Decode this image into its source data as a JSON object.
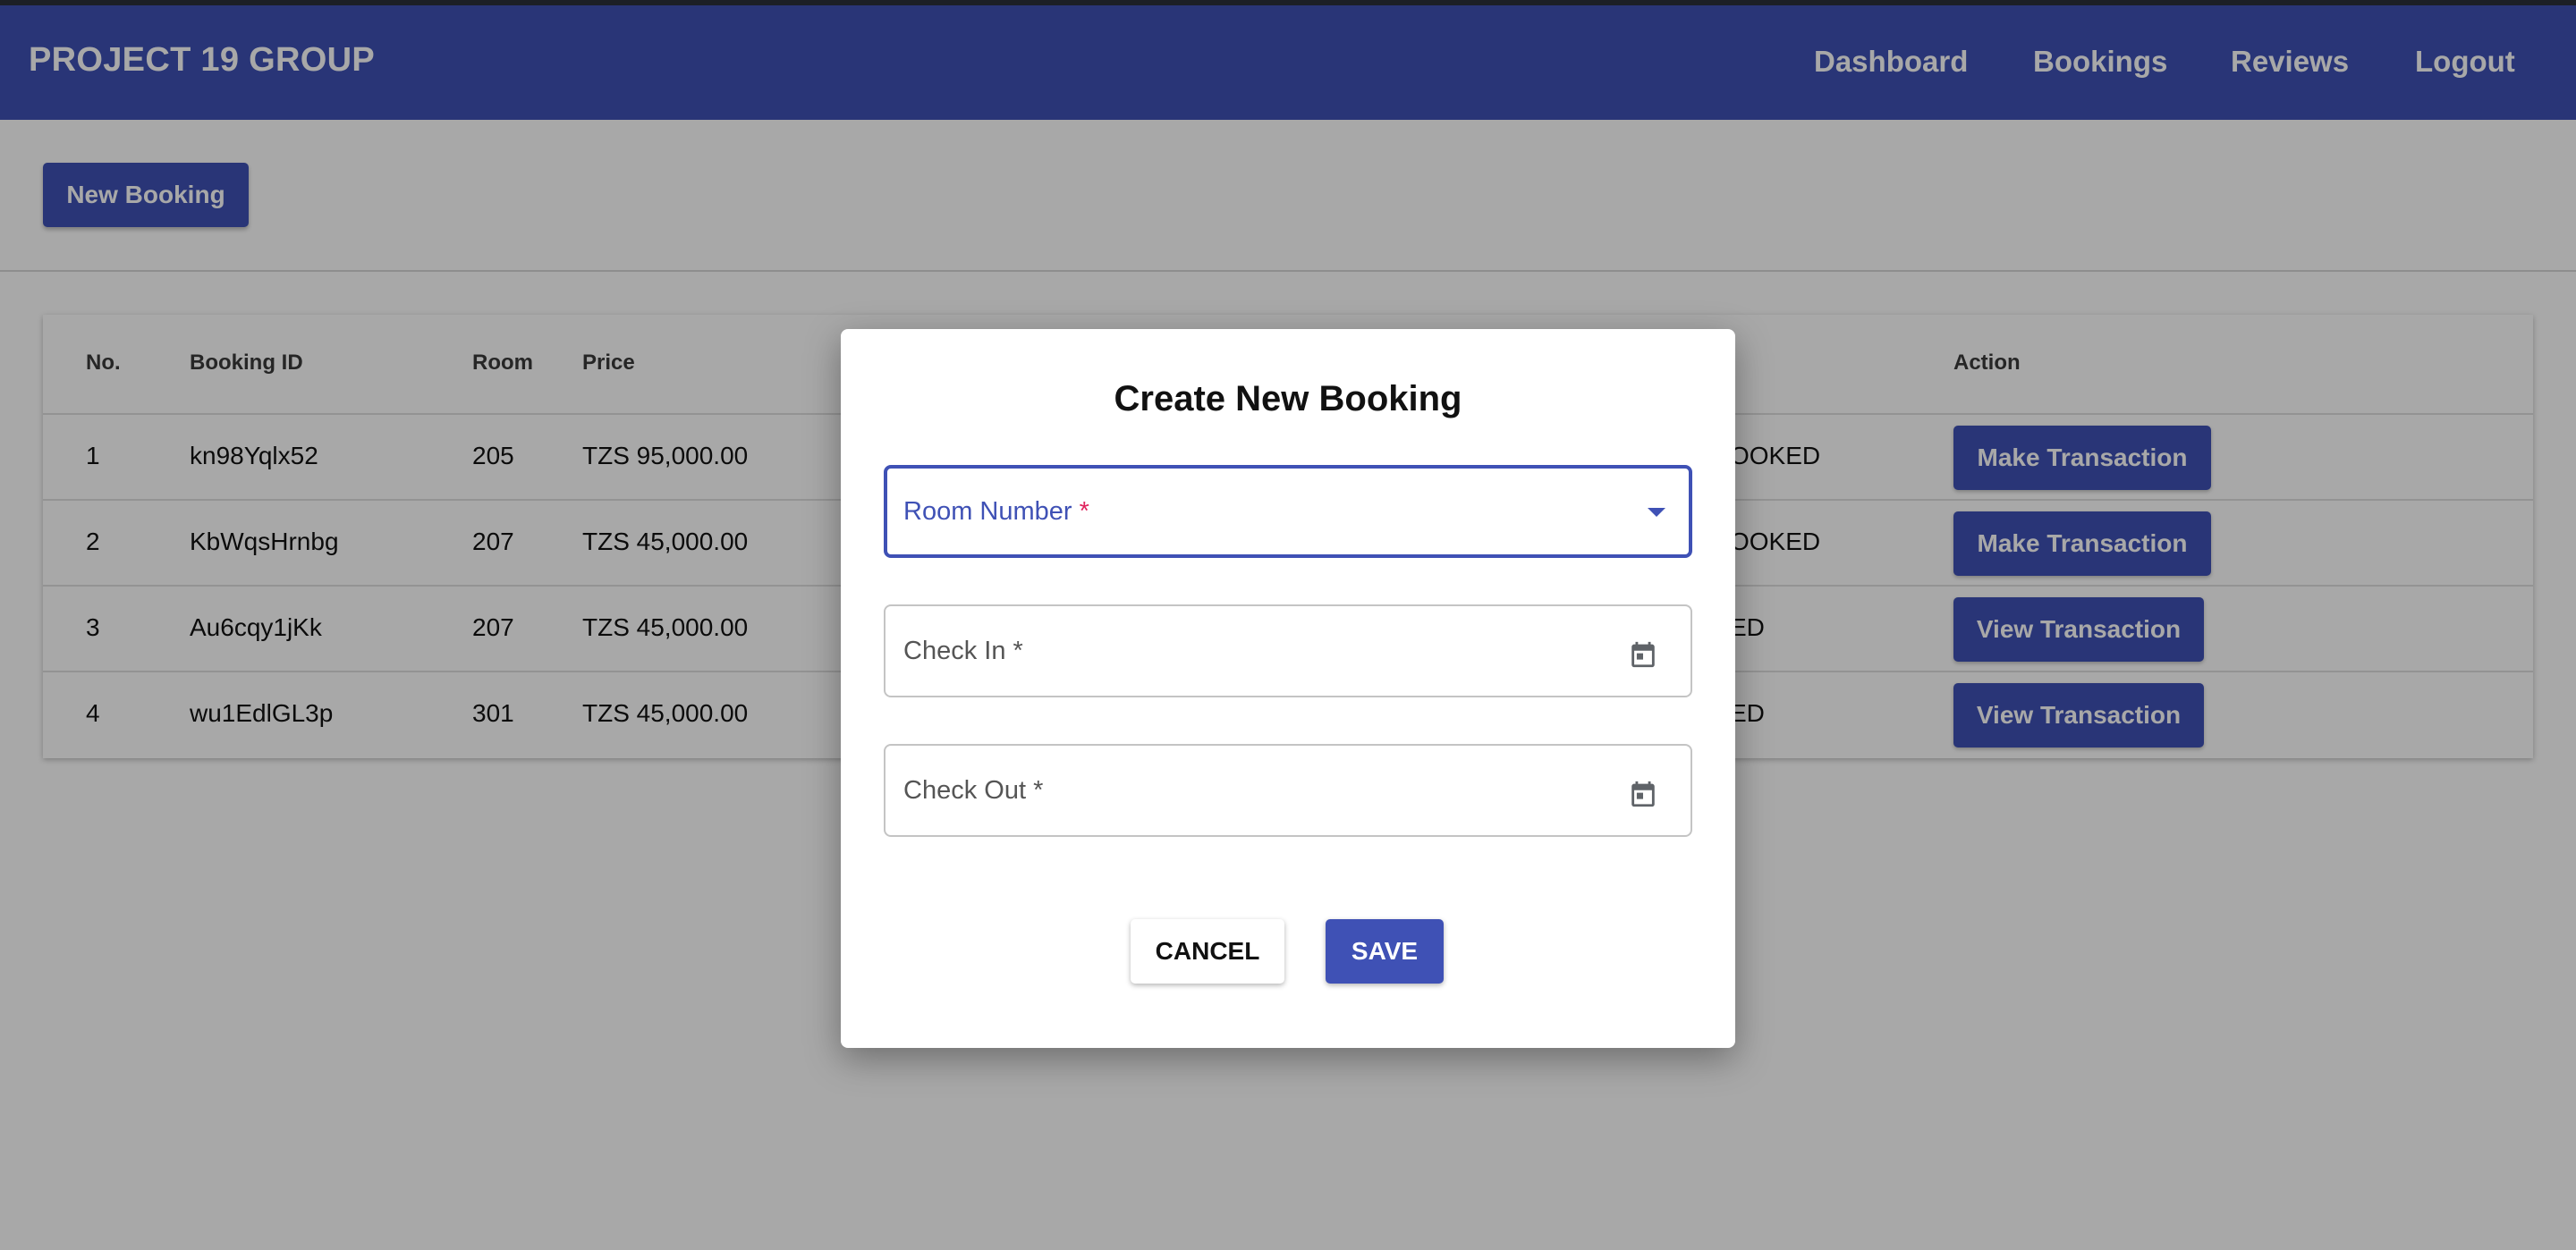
{
  "header": {
    "brand": "PROJECT 19 GROUP",
    "nav": [
      "Dashboard",
      "Bookings",
      "Reviews",
      "Logout"
    ]
  },
  "toolbar": {
    "new_booking_label": "New Booking"
  },
  "table": {
    "columns": [
      "No.",
      "Booking ID",
      "Room",
      "Price",
      "Action"
    ],
    "rows": [
      {
        "no": "1",
        "booking_id": "kn98Yqlx52",
        "room": "205",
        "price": "TZS 95,000.00",
        "status_visible": "OOKED",
        "action": "Make Transaction"
      },
      {
        "no": "2",
        "booking_id": "KbWqsHrnbg",
        "room": "207",
        "price": "TZS 45,000.00",
        "status_visible": "OOKED",
        "action": "Make Transaction"
      },
      {
        "no": "3",
        "booking_id": "Au6cqy1jKk",
        "room": "207",
        "price": "TZS 45,000.00",
        "status_visible": "ED",
        "action": "View Transaction"
      },
      {
        "no": "4",
        "booking_id": "wu1EdlGL3p",
        "room": "301",
        "price": "TZS 45,000.00",
        "status_visible": "ED",
        "action": "View Transaction"
      }
    ]
  },
  "dialog": {
    "title": "Create New Booking",
    "room_number_label": "Room Number",
    "check_in_label": "Check In",
    "check_out_label": "Check Out",
    "required_marker": "*",
    "cancel_label": "CANCEL",
    "save_label": "SAVE"
  },
  "colors": {
    "primary": "#3f51b5",
    "required": "#e0245e",
    "overlay": "rgba(0,0,0,0.34)"
  },
  "icons": {
    "dropdown": "arrow-drop-down-icon",
    "date": "calendar-icon"
  }
}
